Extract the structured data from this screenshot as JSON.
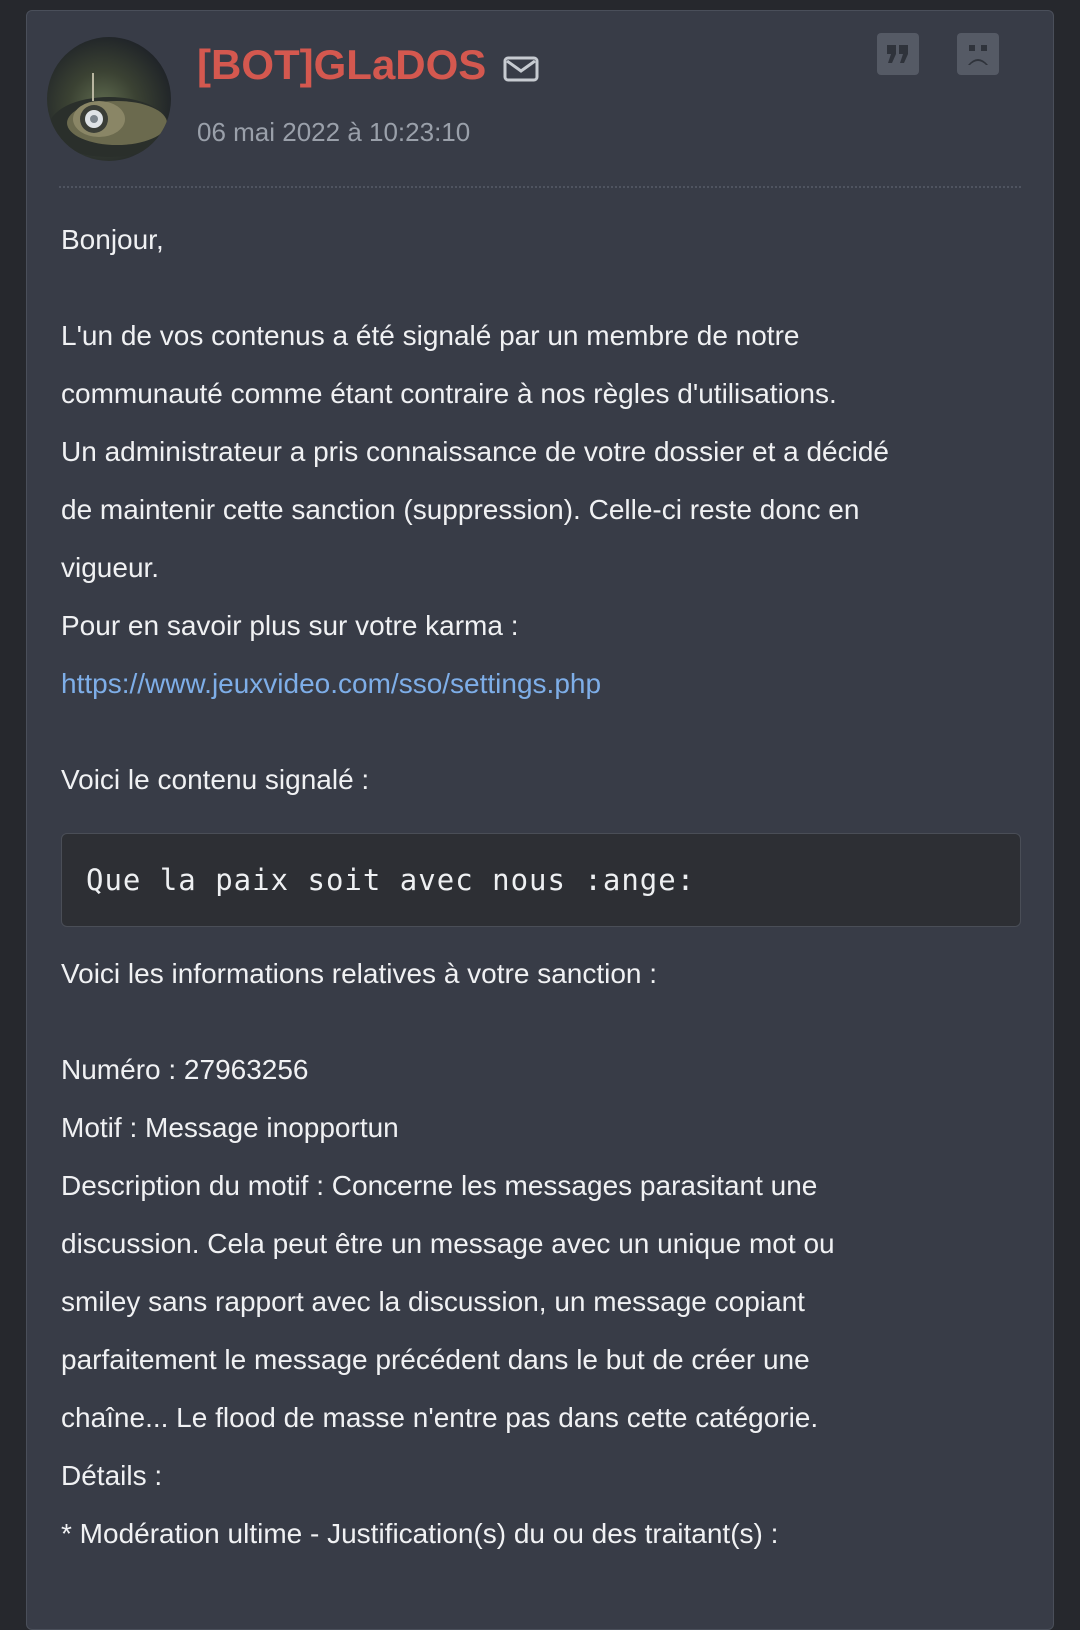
{
  "post": {
    "author": "[BOT]GLaDOS",
    "date": "06 mai 2022 à 10:23:10",
    "actions": {
      "mail_icon": "envelope-icon",
      "quote_icon": "quote-icon",
      "report_icon": "sad-face-icon"
    },
    "body": {
      "greeting": "Bonjour,",
      "line1": "L'un de vos contenus a été signalé par un membre de notre",
      "line2": "communauté comme étant contraire à nos règles d'utilisations.",
      "line3": "Un administrateur a pris connaissance de votre dossier et a décidé",
      "line4": "de maintenir cette sanction (suppression). Celle-ci reste donc en",
      "line5": "vigueur.",
      "line6": "Pour en savoir plus sur votre karma :",
      "link": "https://www.jeuxvideo.com/sso/settings.php",
      "reported_intro": "Voici le contenu signalé :",
      "reported_content": "Que la paix soit avec nous :ange:",
      "sanction_intro": "Voici les informations relatives à votre sanction :",
      "numero": "Numéro : 27963256",
      "motif": "Motif : Message inopportun",
      "desc1": "Description du motif : Concerne les messages parasitant une",
      "desc2": "discussion. Cela peut être un message avec un unique mot ou",
      "desc3": "smiley sans rapport avec la discussion, un message copiant",
      "desc4": "parfaitement le message précédent dans le but de créer une",
      "desc5": "chaîne... Le flood de masse n'entre pas dans cette catégorie.",
      "details": "Détails :",
      "moderation": "* Modération ultime - Justification(s) du ou des traitant(s) :"
    }
  },
  "colors": {
    "background": "#26282d",
    "card": "#383c47",
    "username": "#d4584f",
    "link": "#7eaee8",
    "text": "#f0f1f3",
    "muted": "#9aa0aa"
  }
}
